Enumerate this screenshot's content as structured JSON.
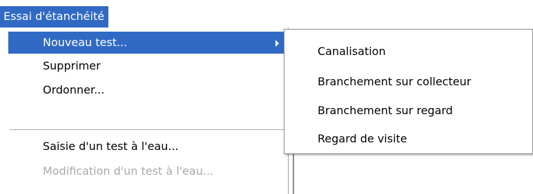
{
  "menubar": {
    "title": "Essai d'étanchéité"
  },
  "menu": {
    "items": [
      {
        "label": "Nouveau test...",
        "selected": true,
        "has_submenu": true
      },
      {
        "label": "Supprimer"
      },
      {
        "label": "Ordonner..."
      },
      {
        "label": "Saisie d'un test à l'eau..."
      },
      {
        "label": "Modification d'un test à l'eau...",
        "disabled": true
      }
    ]
  },
  "submenu": {
    "items": [
      {
        "label": "Canalisation"
      },
      {
        "label": "Branchement sur collecteur"
      },
      {
        "label": "Branchement sur regard"
      },
      {
        "label": "Regard de visite"
      }
    ]
  },
  "colors": {
    "highlight": "#316ac5",
    "disabled_text": "#a8a8a8"
  },
  "icons": {
    "submenu_arrow": "chevron-right-icon"
  }
}
